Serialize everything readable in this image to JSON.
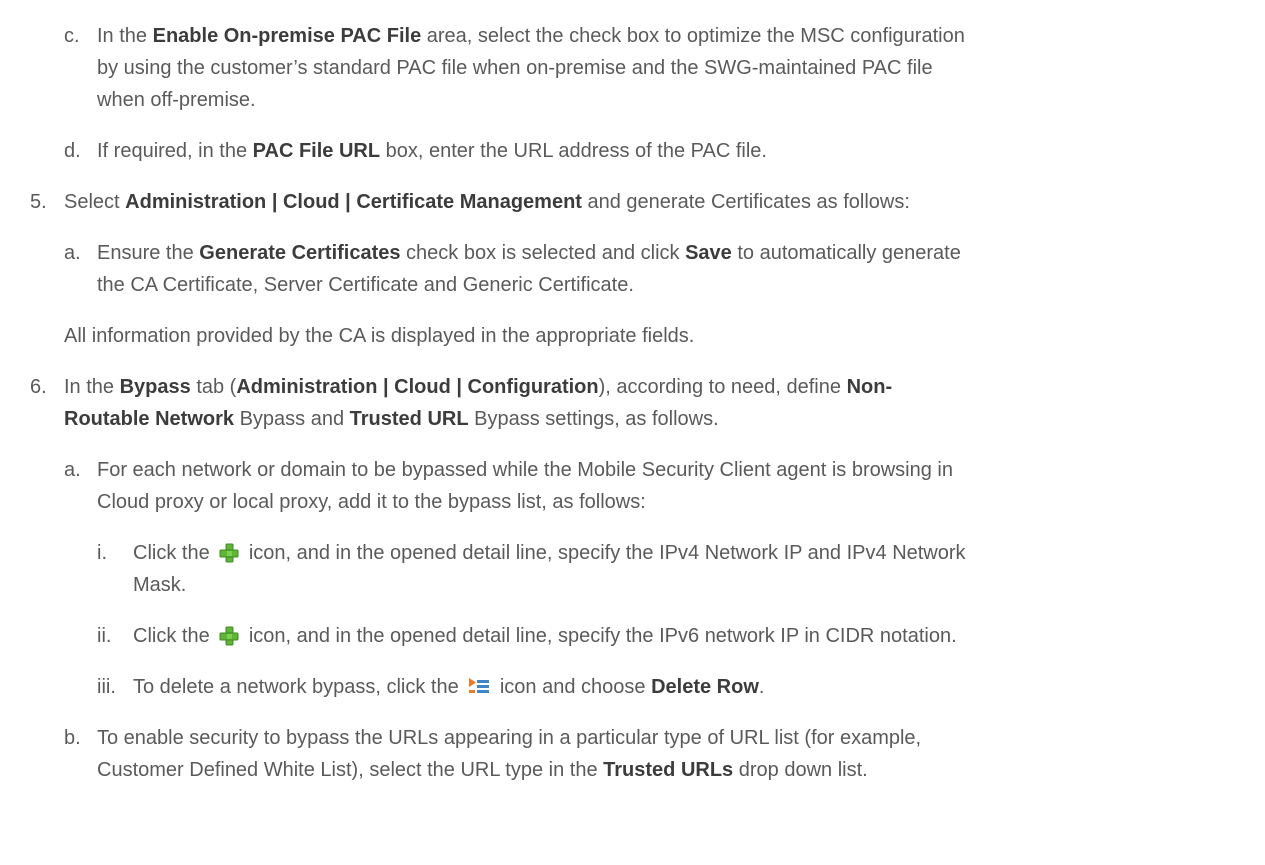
{
  "icons": {
    "add": "plus-icon",
    "row_menu": "row-menu-icon"
  },
  "colors": {
    "text": "#5a5a5a",
    "bold_text": "#3c3c3c",
    "plus_green": "#5fb536",
    "menu_orange": "#f0781e",
    "menu_blue": "#3f86c8"
  },
  "item_c": {
    "marker": "c.",
    "l1": {
      "t1": "In the ",
      "b1": "Enable On-premise PAC File",
      "t2": " area, select the check box to optimize the MSC configuration"
    },
    "l2": "by using the customer’s standard PAC file when on-premise and the SWG-maintained PAC file",
    "l3": "when off-premise."
  },
  "item_d": {
    "marker": "d.",
    "t1": "If required, in the ",
    "b1": "PAC File URL",
    "t2": " box, enter the URL address of the PAC file."
  },
  "step5": {
    "marker": "5.",
    "t1": "Select ",
    "b1": "Administration | Cloud | Certificate Management",
    "t2": " and generate Certificates as follows:",
    "a": {
      "marker": "a.",
      "l1": {
        "t1": "Ensure the ",
        "b1": "Generate Certificates",
        "t2": " check box is selected and click ",
        "b2": "Save",
        "t3": " to automatically generate"
      },
      "l2": "the CA Certificate, Server Certificate and Generic Certificate."
    },
    "note": "All information provided by the CA is displayed in the appropriate fields."
  },
  "step6": {
    "marker": "6.",
    "l1": {
      "t1": "In the ",
      "b1": "Bypass",
      "t2": " tab (",
      "b2": "Administration | Cloud | Configuration",
      "t3": "), according to need, define ",
      "b3": "Non-"
    },
    "l2": {
      "b1": "Routable Network",
      "t1": " Bypass and ",
      "b2": "Trusted URL",
      "t2": " Bypass settings, as follows."
    },
    "a": {
      "marker": "a.",
      "l1": "For each network or domain to be bypassed while the Mobile Security Client agent is browsing in",
      "l2": "Cloud proxy or local proxy, add it to the bypass list, as follows:",
      "i": {
        "marker": "i.",
        "t1": "Click the",
        "t2": "icon, and in the opened detail line, specify the IPv4 Network IP and IPv4 Network",
        "l2": "Mask."
      },
      "ii": {
        "marker": "ii.",
        "t1": "Click the",
        "t2": "icon, and in the opened detail line, specify the IPv6 network IP in CIDR notation."
      },
      "iii": {
        "marker": "iii.",
        "t1": "To delete a network bypass, click the",
        "t2": "icon and choose ",
        "b1": "Delete Row",
        "t3": "."
      }
    },
    "b": {
      "marker": "b.",
      "l1": "To enable security to bypass the URLs appearing in a particular type of URL list (for example,",
      "l2": {
        "t1": "Customer Defined White List), select the URL type in the ",
        "b1": "Trusted URLs",
        "t2": " drop down list."
      }
    }
  }
}
